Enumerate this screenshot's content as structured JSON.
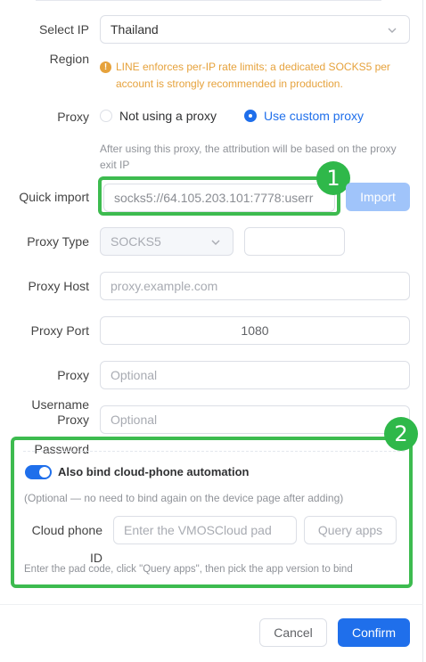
{
  "form": {
    "select_ip_label": "Select IP",
    "select_ip_value": "Thailand",
    "region_label": "Region",
    "warning_text": "LINE enforces per-IP rate limits; a dedicated SOCKS5 per account is strongly recommended in production.",
    "proxy_label": "Proxy",
    "proxy_option_none": "Not using a proxy",
    "proxy_option_custom": "Use custom proxy",
    "proxy_hint": "After using this proxy, the attribution will be based on the proxy exit IP",
    "quick_import_label": "Quick import",
    "quick_import_value": "socks5://64.105.203.101:7778:userr",
    "import_button": "Import",
    "proxy_type_label": "Proxy Type",
    "proxy_type_value": "SOCKS5",
    "proxy_host_label": "Proxy Host",
    "proxy_host_placeholder": "proxy.example.com",
    "proxy_port_label": "Proxy Port",
    "proxy_port_value": "1080",
    "proxy_username_label_1": "Proxy",
    "proxy_username_label_2": "Username",
    "proxy_username_placeholder": "Optional",
    "proxy_password_label_1": "Proxy",
    "proxy_password_label_2": "Password",
    "proxy_password_placeholder": "Optional"
  },
  "cloud": {
    "toggle_label": "Also bind cloud-phone automation",
    "optional_note": "(Optional — no need to bind again on the device page after adding)",
    "cloud_phone_label_1": "Cloud phone",
    "cloud_phone_label_2": "ID",
    "pad_placeholder": "Enter the VMOSCloud pad",
    "query_button": "Query apps",
    "pad_hint": "Enter the pad code, click \"Query apps\", then pick the app version to bind"
  },
  "annotations": {
    "badge_1": "1",
    "badge_2": "2"
  },
  "footer": {
    "cancel_button": "Cancel",
    "confirm_button": "Confirm"
  },
  "colors": {
    "primary": "#1f6feb",
    "warning": "#e6a23c",
    "annotation_green": "#3dbb4f"
  }
}
